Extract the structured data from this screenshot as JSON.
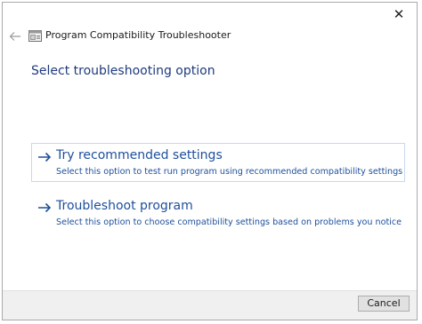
{
  "window": {
    "title": "Program Compatibility Troubleshooter",
    "close_glyph": "✕"
  },
  "heading": "Select troubleshooting option",
  "options": [
    {
      "title": "Try recommended settings",
      "description": "Select this option to test run program using recommended compatibility settings",
      "icon": "right-arrow-icon",
      "selected": true
    },
    {
      "title": "Troubleshoot program",
      "description": "Select this option to choose compatibility settings based on problems you notice",
      "icon": "right-arrow-icon",
      "selected": false
    }
  ],
  "footer": {
    "cancel_label": "Cancel"
  },
  "icons": {
    "back": "back-arrow-icon",
    "app": "troubleshooter-app-icon",
    "close": "close-icon"
  },
  "colors": {
    "accent": "#1e4f9c",
    "heading": "#1e3a7d",
    "selection_border": "#c8d8ec",
    "footer_bg": "#f0f0f0"
  }
}
